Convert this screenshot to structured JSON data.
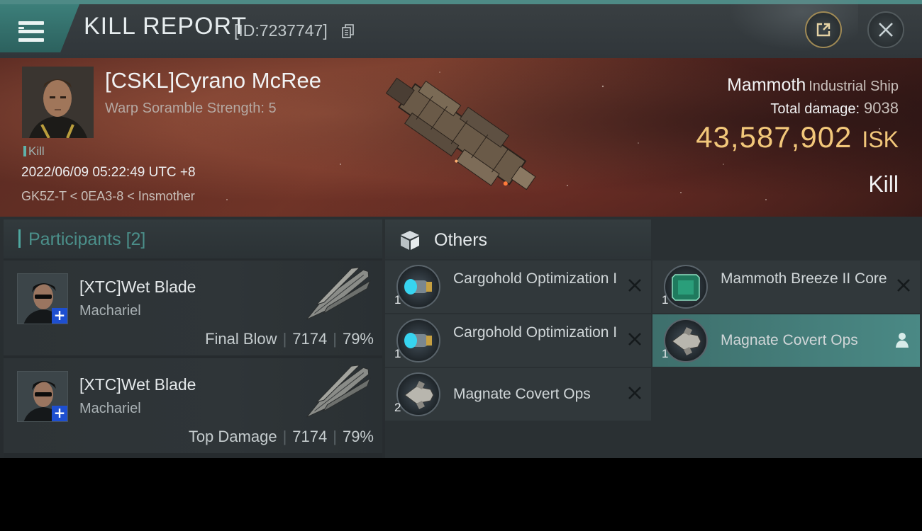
{
  "header": {
    "title": "KILL REPORT",
    "report_id": "[ID:7237747]",
    "icons": [
      "menu-icon",
      "copy-icon",
      "share-icon",
      "close-icon"
    ]
  },
  "victim": {
    "pilot_name": "[CSKL]Cyrano McRee",
    "warp_scramble": "Warp Soramble Strength: 5",
    "badge": "Kill",
    "datetime": "2022/06/09 05:22:49 UTC +8",
    "location": "GK5Z-T < 0EA3-8 < Insmother",
    "ship_name": "Mammoth",
    "ship_class": "Industrial Ship",
    "total_damage_label": "Total damage:",
    "total_damage": "9038",
    "isk_value": "43,587,902",
    "isk_unit": "ISK",
    "result": "Kill"
  },
  "participants": {
    "title": "Participants",
    "count": "[2]",
    "rows": [
      {
        "name": "[XTC]Wet Blade",
        "ship": "Machariel",
        "role": "Final Blow",
        "damage": "7174",
        "percent": "79%"
      },
      {
        "name": "[XTC]Wet Blade",
        "ship": "Machariel",
        "role": "Top Damage",
        "damage": "7174",
        "percent": "79%"
      }
    ]
  },
  "others": {
    "title": "Others",
    "items": [
      {
        "qty": "1",
        "name": "Cargohold Optimization I",
        "icon": "cargohold-rig-icon"
      },
      {
        "qty": "1",
        "name": "Cargohold Optimization I",
        "icon": "cargohold-rig-icon"
      },
      {
        "qty": "2",
        "name": "Magnate Covert Ops",
        "icon": "frigate-icon"
      },
      {
        "qty": "1",
        "name": "Mammoth Breeze II Core",
        "icon": "core-chip-icon"
      },
      {
        "qty": "1",
        "name": "Magnate Covert Ops",
        "icon": "frigate-icon"
      }
    ]
  },
  "colors": {
    "accent": "#4fa8a0",
    "isk": "#f2c77a",
    "selected_row": "#4a8985"
  }
}
